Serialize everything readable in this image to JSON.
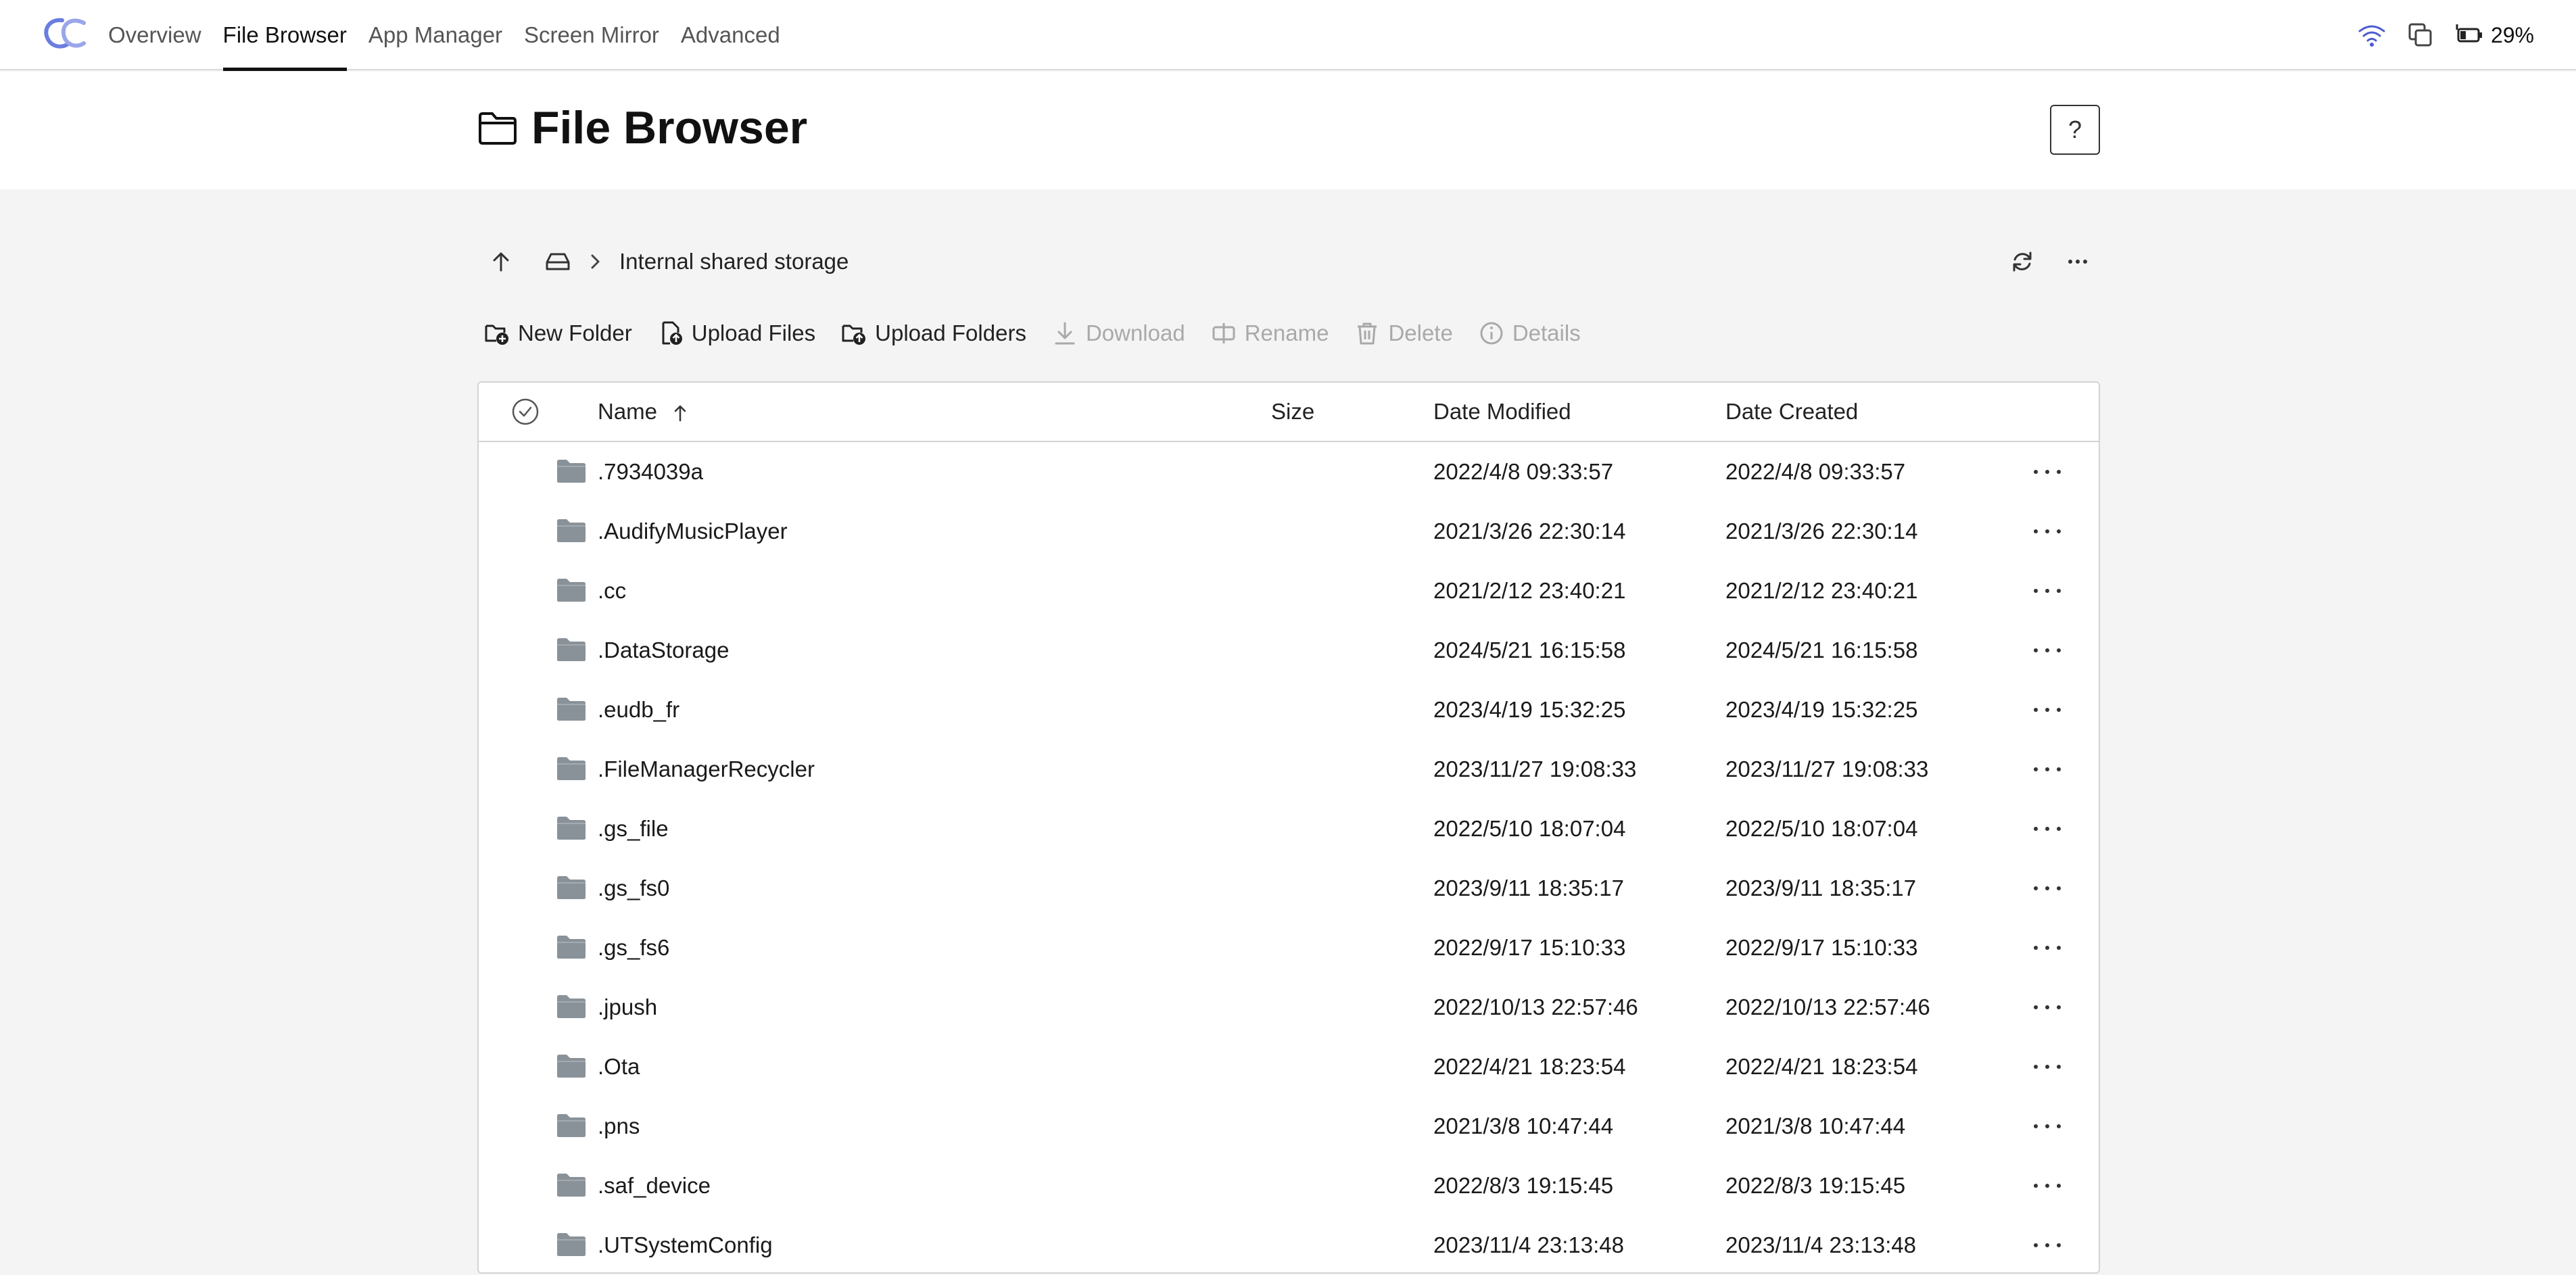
{
  "nav": {
    "items": [
      {
        "label": "Overview",
        "active": false
      },
      {
        "label": "File Browser",
        "active": true
      },
      {
        "label": "App Manager",
        "active": false
      },
      {
        "label": "Screen Mirror",
        "active": false
      },
      {
        "label": "Advanced",
        "active": false
      }
    ],
    "status": {
      "wifi_icon": "wifi-icon",
      "mirror_icon": "copy-icon",
      "battery_icon": "battery-charging-icon",
      "battery_percent": "29%"
    }
  },
  "header": {
    "title": "File Browser",
    "title_icon": "folder-icon",
    "help_label": "?"
  },
  "pathbar": {
    "up_icon": "arrow-up-icon",
    "drive_icon": "drive-icon",
    "crumb": "Internal shared storage",
    "refresh_icon": "refresh-icon",
    "more_icon": "more-icon"
  },
  "toolbar": {
    "new_folder": "New Folder",
    "upload_files": "Upload Files",
    "upload_folders": "Upload Folders",
    "download": "Download",
    "rename": "Rename",
    "delete": "Delete",
    "details": "Details"
  },
  "table": {
    "columns": {
      "name": "Name",
      "size": "Size",
      "modified": "Date Modified",
      "created": "Date Created"
    },
    "sort": {
      "column": "Name",
      "direction": "ascending"
    },
    "rows": [
      {
        "name": ".7934039a",
        "size": "",
        "modified": "2022/4/8 09:33:57",
        "created": "2022/4/8 09:33:57"
      },
      {
        "name": ".AudifyMusicPlayer",
        "size": "",
        "modified": "2021/3/26 22:30:14",
        "created": "2021/3/26 22:30:14"
      },
      {
        "name": ".cc",
        "size": "",
        "modified": "2021/2/12 23:40:21",
        "created": "2021/2/12 23:40:21"
      },
      {
        "name": ".DataStorage",
        "size": "",
        "modified": "2024/5/21 16:15:58",
        "created": "2024/5/21 16:15:58"
      },
      {
        "name": ".eudb_fr",
        "size": "",
        "modified": "2023/4/19 15:32:25",
        "created": "2023/4/19 15:32:25"
      },
      {
        "name": ".FileManagerRecycler",
        "size": "",
        "modified": "2023/11/27 19:08:33",
        "created": "2023/11/27 19:08:33"
      },
      {
        "name": ".gs_file",
        "size": "",
        "modified": "2022/5/10 18:07:04",
        "created": "2022/5/10 18:07:04"
      },
      {
        "name": ".gs_fs0",
        "size": "",
        "modified": "2023/9/11 18:35:17",
        "created": "2023/9/11 18:35:17"
      },
      {
        "name": ".gs_fs6",
        "size": "",
        "modified": "2022/9/17 15:10:33",
        "created": "2022/9/17 15:10:33"
      },
      {
        "name": ".jpush",
        "size": "",
        "modified": "2022/10/13 22:57:46",
        "created": "2022/10/13 22:57:46"
      },
      {
        "name": ".Ota",
        "size": "",
        "modified": "2022/4/21 18:23:54",
        "created": "2022/4/21 18:23:54"
      },
      {
        "name": ".pns",
        "size": "",
        "modified": "2021/3/8 10:47:44",
        "created": "2021/3/8 10:47:44"
      },
      {
        "name": ".saf_device",
        "size": "",
        "modified": "2022/8/3 19:15:45",
        "created": "2022/8/3 19:15:45"
      },
      {
        "name": ".UTSystemConfig",
        "size": "",
        "modified": "2023/11/4 23:13:48",
        "created": "2023/11/4 23:13:48"
      }
    ]
  },
  "colors": {
    "accent": "#4a5bd0",
    "folder": "#8a9299",
    "disabled": "#a9a9a9"
  }
}
